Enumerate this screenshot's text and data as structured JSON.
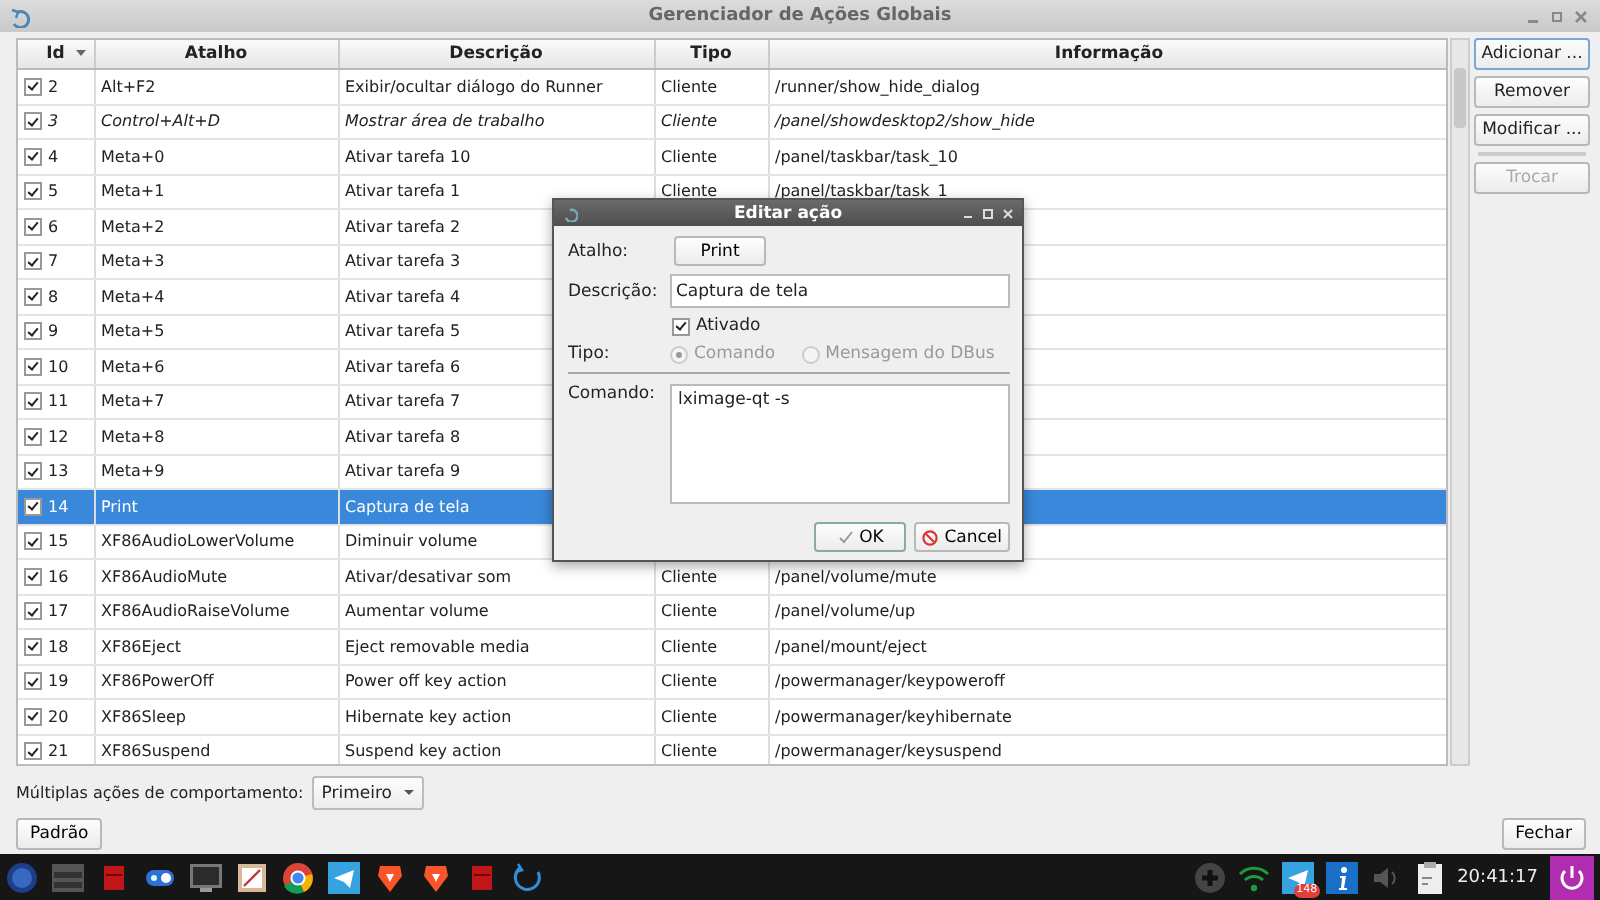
{
  "window": {
    "title": "Gerenciador de Ações Globais"
  },
  "table": {
    "columns": [
      "Id",
      "Atalho",
      "Descrição",
      "Tipo",
      "Informação"
    ],
    "rows": [
      {
        "id": "2",
        "enabled": true,
        "shortcut": "Alt+F2",
        "description": "Exibir/ocultar diálogo do Runner",
        "type": "Cliente",
        "info": "/runner/show_hide_dialog",
        "selected": false,
        "italic": false
      },
      {
        "id": "3",
        "enabled": true,
        "shortcut": "Control+Alt+D",
        "description": "Mostrar área de trabalho",
        "type": "Cliente",
        "info": "/panel/showdesktop2/show_hide",
        "selected": false,
        "italic": true
      },
      {
        "id": "4",
        "enabled": true,
        "shortcut": "Meta+0",
        "description": "Ativar tarefa 10",
        "type": "Cliente",
        "info": "/panel/taskbar/task_10",
        "selected": false,
        "italic": false
      },
      {
        "id": "5",
        "enabled": true,
        "shortcut": "Meta+1",
        "description": "Ativar tarefa 1",
        "type": "Cliente",
        "info": "/panel/taskbar/task_1",
        "selected": false,
        "italic": false
      },
      {
        "id": "6",
        "enabled": true,
        "shortcut": "Meta+2",
        "description": "Ativar tarefa 2",
        "selected": false,
        "italic": false
      },
      {
        "id": "7",
        "enabled": true,
        "shortcut": "Meta+3",
        "description": "Ativar tarefa 3",
        "selected": false,
        "italic": false
      },
      {
        "id": "8",
        "enabled": true,
        "shortcut": "Meta+4",
        "description": "Ativar tarefa 4",
        "selected": false,
        "italic": false
      },
      {
        "id": "9",
        "enabled": true,
        "shortcut": "Meta+5",
        "description": "Ativar tarefa 5",
        "selected": false,
        "italic": false
      },
      {
        "id": "10",
        "enabled": true,
        "shortcut": "Meta+6",
        "description": "Ativar tarefa 6",
        "selected": false,
        "italic": false
      },
      {
        "id": "11",
        "enabled": true,
        "shortcut": "Meta+7",
        "description": "Ativar tarefa 7",
        "selected": false,
        "italic": false
      },
      {
        "id": "12",
        "enabled": true,
        "shortcut": "Meta+8",
        "description": "Ativar tarefa 8",
        "selected": false,
        "italic": false
      },
      {
        "id": "13",
        "enabled": true,
        "shortcut": "Meta+9",
        "description": "Ativar tarefa 9",
        "selected": false,
        "italic": false
      },
      {
        "id": "14",
        "enabled": true,
        "shortcut": "Print",
        "description": "Captura de tela",
        "selected": true,
        "italic": false
      },
      {
        "id": "15",
        "enabled": true,
        "shortcut": "XF86AudioLowerVolume",
        "description": "Diminuir volume",
        "selected": false,
        "italic": false
      },
      {
        "id": "16",
        "enabled": true,
        "shortcut": "XF86AudioMute",
        "description": "Ativar/desativar som",
        "type": "Cliente",
        "info": "/panel/volume/mute",
        "selected": false,
        "italic": false
      },
      {
        "id": "17",
        "enabled": true,
        "shortcut": "XF86AudioRaiseVolume",
        "description": "Aumentar volume",
        "type": "Cliente",
        "info": "/panel/volume/up",
        "selected": false,
        "italic": false
      },
      {
        "id": "18",
        "enabled": true,
        "shortcut": "XF86Eject",
        "description": "Eject removable media",
        "type": "Cliente",
        "info": "/panel/mount/eject",
        "selected": false,
        "italic": false
      },
      {
        "id": "19",
        "enabled": true,
        "shortcut": "XF86PowerOff",
        "description": "Power off key action",
        "type": "Cliente",
        "info": "/powermanager/keypoweroff",
        "selected": false,
        "italic": false
      },
      {
        "id": "20",
        "enabled": true,
        "shortcut": "XF86Sleep",
        "description": "Hibernate key action",
        "type": "Cliente",
        "info": "/powermanager/keyhibernate",
        "selected": false,
        "italic": false
      },
      {
        "id": "21",
        "enabled": true,
        "shortcut": "XF86Suspend",
        "description": "Suspend key action",
        "type": "Cliente",
        "info": "/powermanager/keysuspend",
        "selected": false,
        "italic": false
      }
    ]
  },
  "side_buttons": [
    {
      "kind": "button",
      "label": "Adicionar ...",
      "disabled": false,
      "focused": true
    },
    {
      "kind": "button",
      "label": "Remover",
      "disabled": false,
      "focused": false
    },
    {
      "kind": "button",
      "label": "Modificar ...",
      "disabled": false,
      "focused": false
    },
    {
      "kind": "separator"
    },
    {
      "kind": "button",
      "label": "Trocar",
      "disabled": true,
      "focused": false
    }
  ],
  "behavior": {
    "label": "Múltiplas ações de comportamento:",
    "value": "Primeiro"
  },
  "footer": {
    "default_button": "Padrão",
    "close_button": "Fechar"
  },
  "dialog": {
    "title": "Editar ação",
    "shortcut_label": "Atalho:",
    "shortcut": "Print",
    "description_label": "Descrição:",
    "description": "Captura de tela",
    "enabled": {
      "label": "Ativado",
      "checked": true
    },
    "type_label": "Tipo:",
    "types": [
      {
        "label": "Comando",
        "selected": true,
        "disabled": true
      },
      {
        "label": "Mensagem do DBus",
        "selected": false,
        "disabled": true
      }
    ],
    "command_label": "Comando:",
    "command": "lximage-qt -s",
    "ok": "OK",
    "cancel": "Cancel"
  },
  "taskbar": {
    "badge": "148",
    "clock": "20:41:17"
  }
}
